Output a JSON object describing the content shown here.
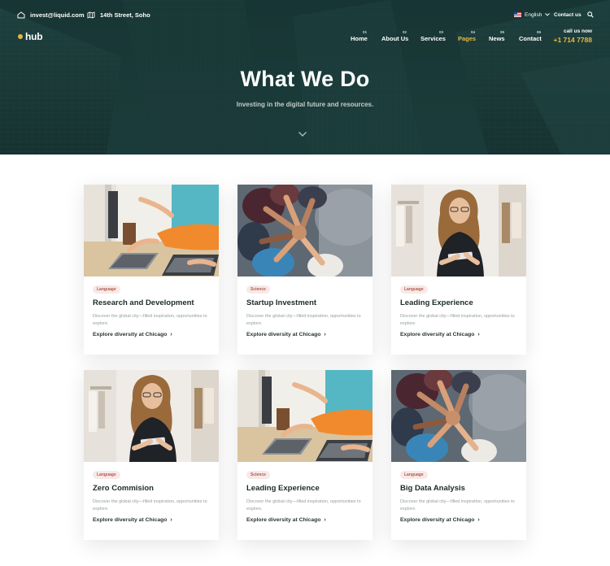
{
  "topbar": {
    "email": "invest@liquid.com",
    "address": "14th Street, Soho",
    "language": "English",
    "contact": "Contact us"
  },
  "brand": {
    "logo_text": "hub",
    "accent": "#e9b93f"
  },
  "nav": {
    "items": [
      {
        "num": "01",
        "label": "Home"
      },
      {
        "num": "02",
        "label": "About Us"
      },
      {
        "num": "03",
        "label": "Services"
      },
      {
        "num": "04",
        "label": "Pages"
      },
      {
        "num": "05",
        "label": "News"
      },
      {
        "num": "06",
        "label": "Contact"
      }
    ],
    "active": "Pages"
  },
  "cta": {
    "label": "call us now",
    "phone": "+1 714 7788"
  },
  "hero": {
    "title": "What We Do",
    "subtitle": "Investing in the digital future and resources."
  },
  "cards": [
    {
      "tag": "Language",
      "title": "Research and Development",
      "desc": "Discover the global city—filled inspiration, opportunities to explore.",
      "link": "Explore diversity at Chicago",
      "image": "laptop-desk"
    },
    {
      "tag": "Science",
      "title": "Startup Investment",
      "desc": "Discover the global city—filled inspiration, opportunities to explore.",
      "link": "Explore diversity at Chicago",
      "image": "team-hands"
    },
    {
      "tag": "Language",
      "title": "Leading Experience",
      "desc": "Discover the global city—filled inspiration, opportunities to explore.",
      "link": "Explore diversity at Chicago",
      "image": "woman-tablet"
    },
    {
      "tag": "Language",
      "title": "Zero Commision",
      "desc": "Discover the global city—filled inspiration, opportunities to explore.",
      "link": "Explore diversity at Chicago",
      "image": "woman-tablet"
    },
    {
      "tag": "Science",
      "title": "Leading Experience",
      "desc": "Discover the global city—filled inspiration, opportunities to explore.",
      "link": "Explore diversity at Chicago",
      "image": "laptop-desk"
    },
    {
      "tag": "Language",
      "title": "Big Data Analysis",
      "desc": "Discover the global city—filled inspiration, opportunities to explore.",
      "link": "Explore diversity at Chicago",
      "image": "team-hands"
    }
  ],
  "icons": {
    "email": "home-mail-icon",
    "address": "map-icon",
    "flag": "us-flag-icon",
    "dropdown": "chevron-down-icon",
    "search": "search-icon",
    "scroll": "chevron-down-icon",
    "link_arrow": "chevron-right-icon"
  }
}
